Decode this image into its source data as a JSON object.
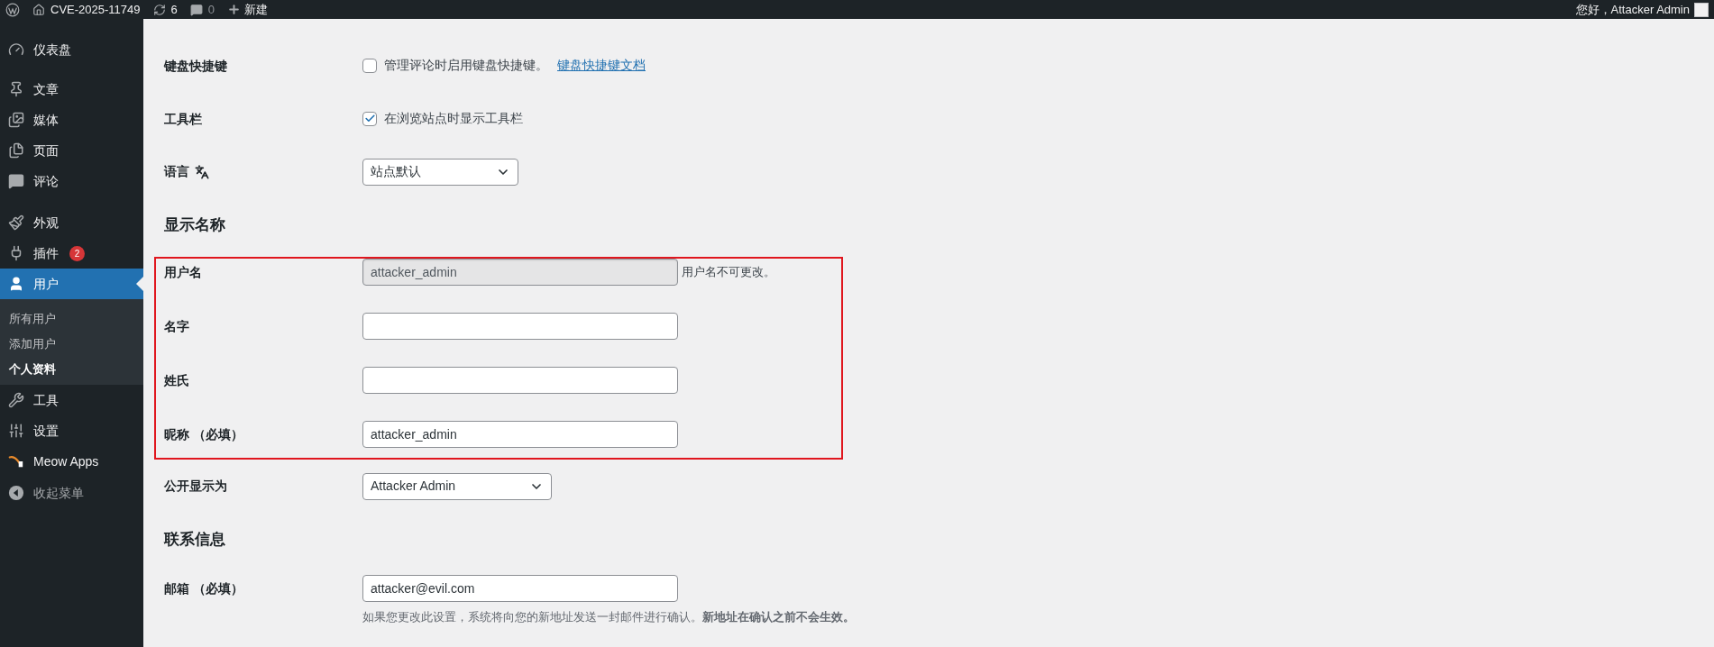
{
  "admin_bar": {
    "site_name": "CVE-2025-11749",
    "updates": "6",
    "comments": "0",
    "new": "新建",
    "greeting": "您好，Attacker Admin"
  },
  "sidebar": {
    "items": [
      {
        "label": "仪表盘",
        "selected": false
      },
      {
        "label": "文章",
        "selected": false
      },
      {
        "label": "媒体",
        "selected": false
      },
      {
        "label": "页面",
        "selected": false
      },
      {
        "label": "评论",
        "selected": false
      },
      {
        "label": "外观",
        "selected": false
      },
      {
        "label": "插件",
        "selected": false,
        "badge": "2"
      },
      {
        "label": "用户",
        "selected": true,
        "children": [
          {
            "label": "所有用户",
            "selected": false
          },
          {
            "label": "添加用户",
            "selected": false
          },
          {
            "label": "个人资料",
            "selected": true
          }
        ]
      },
      {
        "label": "工具",
        "selected": false
      },
      {
        "label": "设置",
        "selected": false
      },
      {
        "label": "Meow Apps",
        "selected": false
      }
    ],
    "collapse_label": "收起菜单"
  },
  "rows": [
    {
      "kind": "checkbox",
      "label": "键盘快捷键",
      "text": "管理评论时启用键盘快捷键。",
      "link": "键盘快捷键文档",
      "checked": false,
      "highlighted": false
    },
    {
      "kind": "checkbox",
      "label": "工具栏",
      "text": "在浏览站点时显示工具栏",
      "checked": true,
      "highlighted": false
    },
    {
      "kind": "language",
      "label": "语言",
      "value": "站点默认",
      "highlighted": false
    },
    {
      "kind": "heading",
      "label": "显示名称",
      "highlighted": false
    },
    {
      "kind": "field",
      "label": "用户名",
      "value": "attacker_admin",
      "disabled": true,
      "note": "用户名不可更改。",
      "highlighted": true
    },
    {
      "kind": "field",
      "label": "名字",
      "disabled": false,
      "highlighted": true
    },
    {
      "kind": "field",
      "label": "姓氏",
      "disabled": false,
      "highlighted": true
    },
    {
      "kind": "field",
      "label": "昵称 （必填）",
      "value": "attacker_admin",
      "disabled": false,
      "highlighted": true
    },
    {
      "kind": "select",
      "label": "公开显示为",
      "value": "Attacker Admin",
      "highlighted": false
    },
    {
      "kind": "heading",
      "label": "联系信息",
      "highlighted": false
    },
    {
      "kind": "field",
      "label": "邮箱 （必填）",
      "value": "attacker@evil.com",
      "disabled": false,
      "highlighted": false,
      "description": "如果您更改此设置，系统将向您的新地址发送一封邮件进行确认。**新地址在确认之前不会生效。**"
    }
  ]
}
